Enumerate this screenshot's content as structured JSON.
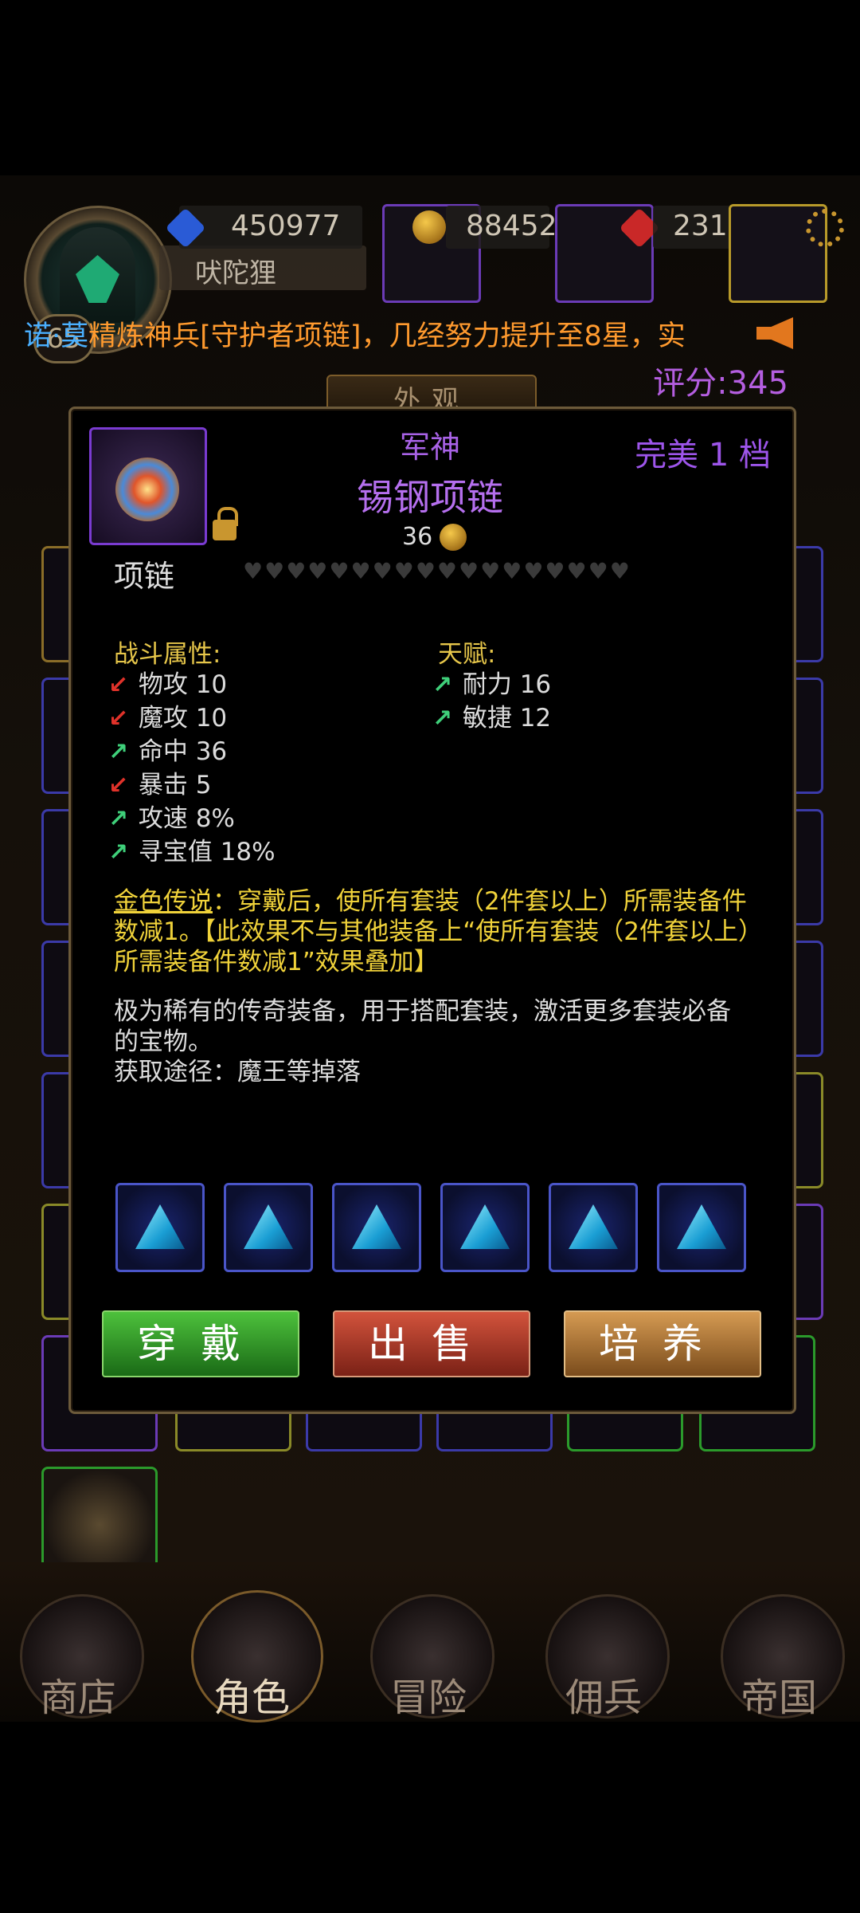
{
  "header": {
    "player_name": "吠陀狸",
    "level": "65",
    "resources": [
      {
        "name": "gem",
        "value": "450977"
      },
      {
        "name": "gold",
        "value": "88452"
      },
      {
        "name": "ruby",
        "value": "231"
      }
    ],
    "score": "评分:345",
    "appearance_tab": "外观"
  },
  "ticker": {
    "player": "诺·莫",
    "message": "精炼神兵[守护者项链]，几经努力提升至8星，实"
  },
  "item": {
    "prefix": "军神",
    "name": "锡钢项链",
    "tier": "完美 1 档",
    "coin_count": "36",
    "type": "项链",
    "hearts": "♥♥♥♥♥♥♥♥♥♥♥♥♥♥♥♥♥♥",
    "combat_title": "战斗属性:",
    "combat_stats": [
      {
        "label": "物攻 10",
        "dir": "down"
      },
      {
        "label": "魔攻 10",
        "dir": "down"
      },
      {
        "label": "命中 36",
        "dir": "up"
      },
      {
        "label": "暴击 5",
        "dir": "down"
      },
      {
        "label": "攻速 8%",
        "dir": "up"
      },
      {
        "label": "寻宝值 18%",
        "dir": "up"
      }
    ],
    "talent_title": "天赋:",
    "talent_stats": [
      {
        "label": "耐力 16",
        "dir": "up"
      },
      {
        "label": "敏捷 12",
        "dir": "up"
      }
    ],
    "legend_label": "金色传说",
    "legend_text": "：穿戴后，使所有套装（2件套以上）所需装备件数减1。【此效果不与其他装备上“使所有套装（2件套以上）所需装备件数减1”效果叠加】",
    "description": "极为稀有的传奇装备，用于搭配套装，激活更多套装必备的宝物。",
    "source": "获取途径：魔王等掉落",
    "socket_count": 6
  },
  "actions": {
    "wear": "穿戴",
    "sell": "出售",
    "train": "培养"
  },
  "nav": [
    {
      "label": "商店",
      "active": false
    },
    {
      "label": "角色",
      "active": true
    },
    {
      "label": "冒险",
      "active": false
    },
    {
      "label": "佣兵",
      "active": false
    },
    {
      "label": "帝国",
      "active": false
    }
  ],
  "colors": {
    "epic_purple": "#b56fee",
    "legend_gold": "#f0d23a",
    "up_green": "#3fd07a",
    "down_red": "#e0322a"
  }
}
